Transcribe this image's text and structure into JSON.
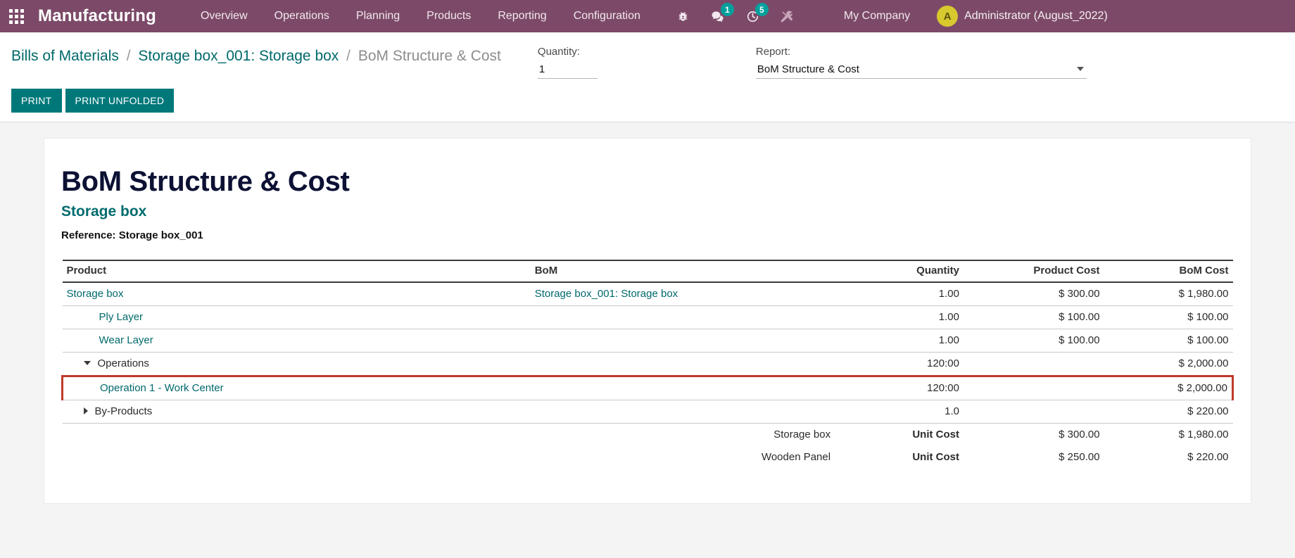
{
  "navbar": {
    "apps_icon": "apps-grid-icon",
    "brand": "Manufacturing",
    "menu_items": [
      {
        "label": "Overview"
      },
      {
        "label": "Operations"
      },
      {
        "label": "Planning"
      },
      {
        "label": "Products"
      },
      {
        "label": "Reporting"
      },
      {
        "label": "Configuration"
      }
    ],
    "systray": [
      {
        "icon": "bug-icon",
        "badge": ""
      },
      {
        "icon": "messages-icon",
        "badge": "1"
      },
      {
        "icon": "activities-clock-icon",
        "badge": "5"
      },
      {
        "icon": "tools-icon",
        "badge": ""
      }
    ],
    "company": "My Company",
    "avatar_initial": "A",
    "user_name": "Administrator (August_2022)",
    "accent_badge_color": "#00A09D",
    "bar_color": "#7C4A68"
  },
  "control_panel": {
    "breadcrumb": {
      "root": "Bills of Materials",
      "parent": "Storage box_001: Storage box",
      "current": "BoM Structure & Cost",
      "separator": "/"
    },
    "quantity": {
      "label": "Quantity:",
      "value": "1",
      "placeholder": "1"
    },
    "report": {
      "label": "Report:",
      "value": "BoM Structure & Cost",
      "options": [
        "BoM Structure & Cost"
      ]
    },
    "buttons": {
      "print": "PRINT",
      "print_unfolded": "PRINT UNFOLDED"
    },
    "button_color": "#00787A"
  },
  "report": {
    "title": "BoM Structure & Cost",
    "subtitle": "Storage box",
    "reference": "Reference: Storage box_001",
    "table": {
      "headers": {
        "product": "Product",
        "bom": "BoM",
        "quantity": "Quantity",
        "product_cost": "Product Cost",
        "bom_cost": "BoM Cost"
      },
      "rows": [
        {
          "product": "Storage box",
          "indent": "ind-0",
          "product_style": "lnk",
          "toggle": "none",
          "bom": "Storage box_001: Storage box",
          "bom_style": "lnk",
          "quantity": "1.00",
          "product_cost": "$ 300.00",
          "bom_cost": "$ 1,980.00",
          "highlight": false
        },
        {
          "product": "Ply Layer",
          "indent": "ind-1",
          "product_style": "lnk",
          "toggle": "none",
          "bom": "",
          "bom_style": "plain",
          "quantity": "1.00",
          "product_cost": "$ 100.00",
          "bom_cost": "$ 100.00",
          "highlight": false
        },
        {
          "product": "Wear Layer",
          "indent": "ind-1",
          "product_style": "lnk",
          "toggle": "none",
          "bom": "",
          "bom_style": "plain",
          "quantity": "1.00",
          "product_cost": "$ 100.00",
          "bom_cost": "$ 100.00",
          "highlight": false
        },
        {
          "product": "Operations",
          "indent": "ind-fold",
          "product_style": "plain",
          "toggle": "down",
          "bom": "",
          "bom_style": "plain",
          "quantity": "120:00",
          "product_cost": "",
          "bom_cost": "$ 2,000.00",
          "highlight": false
        },
        {
          "product": "Operation 1 - Work Center",
          "indent": "ind-sub",
          "product_style": "lnk",
          "toggle": "none",
          "bom": "",
          "bom_style": "plain",
          "quantity": "120:00",
          "product_cost": "",
          "bom_cost": "$ 2,000.00",
          "highlight": true
        },
        {
          "product": "By-Products",
          "indent": "ind-fold",
          "product_style": "plain",
          "toggle": "right",
          "bom": "",
          "bom_style": "plain",
          "quantity": "1.0",
          "product_cost": "",
          "bom_cost": "$ 220.00",
          "highlight": false
        }
      ],
      "footer": [
        {
          "product": "Storage box",
          "label": "Unit Cost",
          "product_cost": "$ 300.00",
          "bom_cost": "$ 1,980.00"
        },
        {
          "product": "Wooden Panel",
          "label": "Unit Cost",
          "product_cost": "$ 250.00",
          "bom_cost": "$ 220.00"
        }
      ]
    },
    "highlight_color": "#c0392b"
  }
}
